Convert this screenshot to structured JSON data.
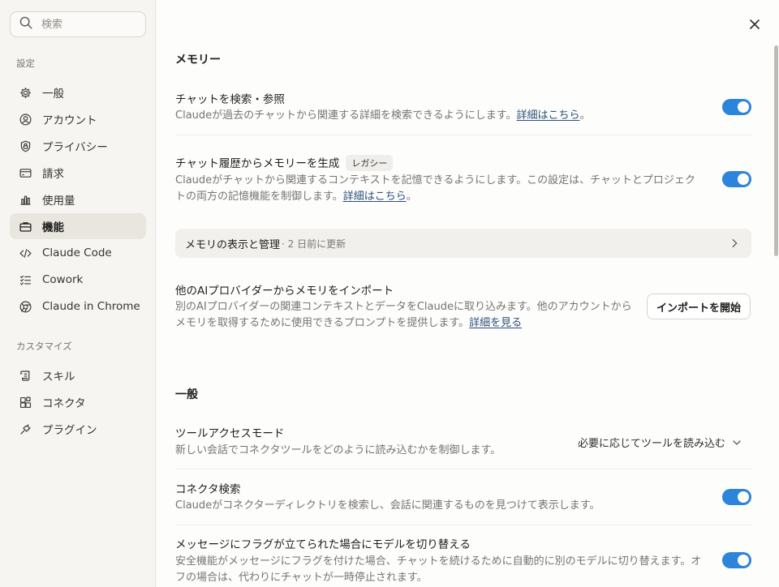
{
  "sidebar": {
    "search_placeholder": "検索",
    "settings_label": "設定",
    "customize_label": "カスタマイズ",
    "items": [
      {
        "label": "一般",
        "icon": "gear-icon"
      },
      {
        "label": "アカウント",
        "icon": "user-circle-icon"
      },
      {
        "label": "プライバシー",
        "icon": "shield-lock-icon"
      },
      {
        "label": "請求",
        "icon": "credit-card-icon"
      },
      {
        "label": "使用量",
        "icon": "bar-chart-icon"
      },
      {
        "label": "機能",
        "icon": "briefcase-icon",
        "active": true
      },
      {
        "label": "Claude Code",
        "icon": "code-icon"
      },
      {
        "label": "Cowork",
        "icon": "checklist-icon"
      },
      {
        "label": "Claude in Chrome",
        "icon": "chrome-icon"
      }
    ],
    "custom_items": [
      {
        "label": "スキル",
        "icon": "scroll-icon"
      },
      {
        "label": "コネクタ",
        "icon": "blocks-icon"
      },
      {
        "label": "プラグイン",
        "icon": "plug-icon"
      }
    ]
  },
  "memory": {
    "heading": "メモリー",
    "search_chats": {
      "title": "チャットを検索・参照",
      "desc": "Claudeが過去のチャットから関連する詳細を検索できるようにします。",
      "link": "詳細はこちら",
      "tail": "。",
      "enabled": true
    },
    "generate": {
      "title": "チャット履歴からメモリーを生成",
      "badge": "レガシー",
      "desc": "Claudeがチャットから関連するコンテキストを記憶できるようにします。この設定は、チャットとプロジェクトの両方の記憶機能を制御します。",
      "link": "詳細はこちら",
      "tail": "。",
      "enabled": true
    },
    "manage": {
      "label": "メモリの表示と管理",
      "sub": "· 2 日前に更新"
    },
    "import": {
      "title": "他のAIプロバイダーからメモリをインポート",
      "desc": "別のAIプロバイダーの関連コンテキストとデータをClaudeに取り込みます。他のアカウントからメモリを取得するために使用できるプロンプトを提供します。",
      "link": "詳細を見る",
      "button": "インポートを開始"
    }
  },
  "general": {
    "heading": "一般",
    "tool_access": {
      "title": "ツールアクセスモード",
      "desc": "新しい会話でコネクタツールをどのように読み込むかを制御します。",
      "value": "必要に応じてツールを読み込む"
    },
    "connector_search": {
      "title": "コネクタ検索",
      "desc": "Claudeがコネクターディレクトリを検索し、会話に関連するものを見つけて表示します。",
      "enabled": true
    },
    "flag_switch": {
      "title": "メッセージにフラグが立てられた場合にモデルを切り替える",
      "desc": "安全機能がメッセージにフラグを付けた場合、チャットを続けるために自動的に別のモデルに切り替えます。オフの場合は、代わりにチャットが一時停止されます。",
      "enabled": true
    }
  },
  "colors": {
    "toggle_on": "#2c84db",
    "link": "#2b4f7a",
    "sidebar_active": "#e9e6df"
  }
}
